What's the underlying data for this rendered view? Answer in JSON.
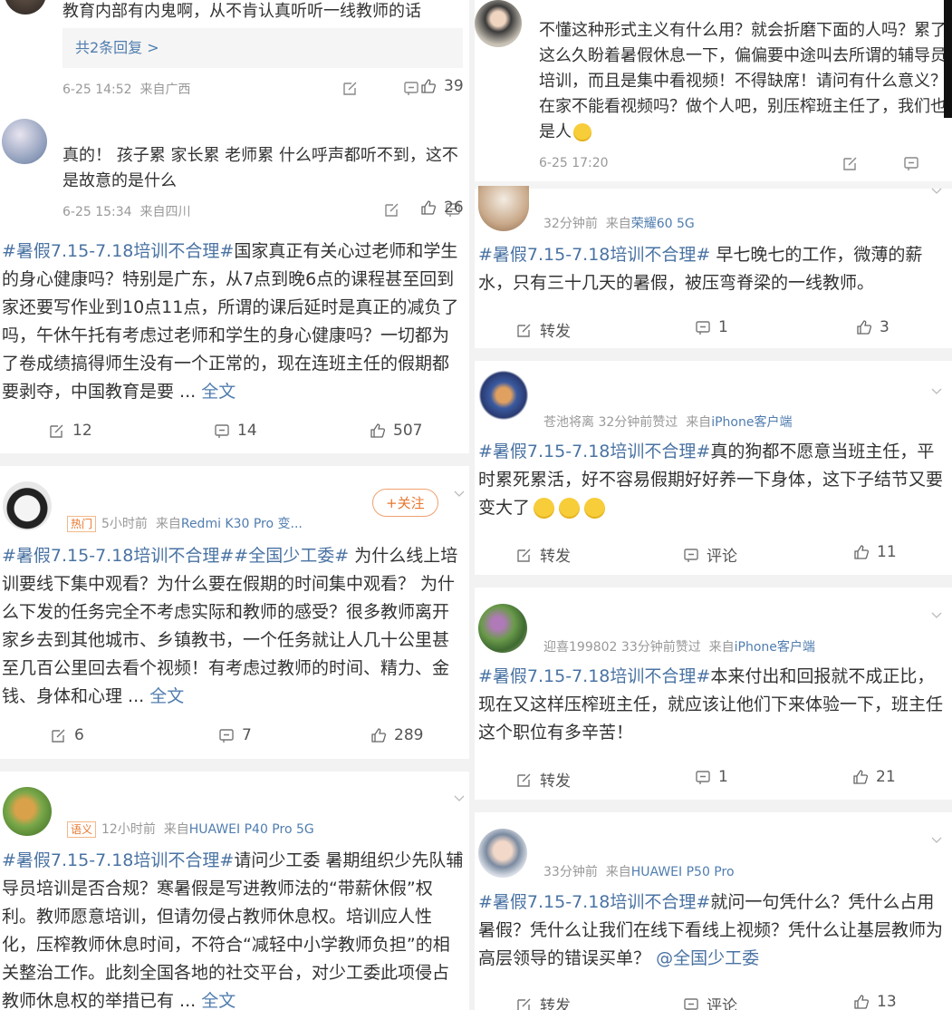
{
  "left": {
    "reply1": {
      "text": "教育内部有内鬼啊，从不肯认真听听一线教师的话",
      "replies_link": "共2条回复 >",
      "time": "6-25 14:52",
      "from": "来自广西",
      "likes": "39"
    },
    "reply2": {
      "text": "真的！ 孩子累 家长累 老师累 什么呼声都听不到，这不是故意的是什么",
      "time": "6-25 15:34",
      "from": "来自四川",
      "likes": "26"
    },
    "post1": {
      "hashtag": "#暑假7.15-7.18培训不合理#",
      "body": "国家真正有关心过老师和学生的身心健康吗？特别是广东，从7点到晚6点的课程甚至回到家还要写作业到10点11点，所谓的课后延时是真正的减负了吗，午休午托有考虑过老师和学生的身心健康吗？一切都为了卷成绩搞得师生没有一个正常的，现在连班主任的假期都要剥夺，中国教育是要 ...",
      "more": "全文",
      "reposts": "12",
      "comments": "14",
      "likes": "507"
    },
    "post2": {
      "badge": "热门",
      "time": "5小时前",
      "from_prefix": "来自",
      "from": "Redmi K30 Pro 变...",
      "follow": "+关注",
      "hashtag": "#暑假7.15-7.18培训不合理##全国少工委#",
      "body": " 为什么线上培训要线下集中观看？为什么要在假期的时间集中观看？ 为什么下发的任务完全不考虑实际和教师的感受？很多教师离开家乡去到其他城市、乡镇教书，一个任务就让人几十公里甚至几百公里回去看个视频！有考虑过教师的时间、精力、金钱、身体和心理 ...",
      "more": "全文",
      "reposts": "6",
      "comments": "7",
      "likes": "289"
    },
    "post3": {
      "badge": "语义",
      "time": "12小时前",
      "from_prefix": "来自",
      "from": "HUAWEI P40 Pro 5G",
      "hashtag": "#暑假7.15-7.18培训不合理#",
      "body": "请问少工委 暑期组织少先队辅导员培训是否合规？寒暑假是写进教师法的“带薪休假”权利。教师愿意培训，但请勿侵占教师休息权。培训应人性化，压榨教师休息时间，不符合“减轻中小学教师负担”的相关整治工作。此刻全国各地的社交平台，对少工委此项侵占教师休息权的举措已有 ...",
      "more": "全文"
    }
  },
  "right": {
    "reply1": {
      "text": "不懂这种形式主义有什么用？就会折磨下面的人吗？累了这么久盼着暑假休息一下，偏偏要中途叫去所谓的辅导员培训，而且是集中看视频！不得缺席！请问有什么意义？在家不能看视频吗？做个人吧，别压榨班主任了，我们也是人",
      "time": "6-25 17:20"
    },
    "post1": {
      "time": "32分钟前",
      "from_prefix": "来自",
      "from": "荣耀60 5G",
      "hashtag": "#暑假7.15-7.18培训不合理#",
      "body": " 早七晚七的工作，微薄的薪水，只有三十几天的暑假，被压弯脊梁的一线教师。",
      "repost": "转发",
      "comments": "1",
      "likes": "3"
    },
    "post2": {
      "user": "苍池将离",
      "time": "32分钟前赞过",
      "from_prefix": "来自",
      "from": "iPhone客户端",
      "hashtag": "#暑假7.15-7.18培训不合理#",
      "body": "真的狗都不愿意当班主任，平时累死累活，好不容易假期好好养一下身体，这下子结节又要变大了",
      "repost": "转发",
      "comment": "评论",
      "likes": "11"
    },
    "post3": {
      "user": "迎喜199802",
      "time": "33分钟前赞过",
      "from_prefix": "来自",
      "from": "iPhone客户端",
      "hashtag": "#暑假7.15-7.18培训不合理#",
      "body": "本来付出和回报就不成正比，现在又这样压榨班主任，就应该让他们下来体验一下，班主任这个职位有多辛苦！",
      "repost": "转发",
      "comments": "1",
      "likes": "21"
    },
    "post4": {
      "time": "33分钟前",
      "from_prefix": "来自",
      "from": "HUAWEI P50 Pro",
      "hashtag": "#暑假7.15-7.18培训不合理#",
      "body": "就问一句凭什么？凭什么占用暑假？凭什么让我们在线下看线上视频？凭什么让基层教师为高层领导的错误买单？",
      "mention": "@全国少工委",
      "repost": "转发",
      "comment": "评论",
      "likes": "13"
    }
  },
  "colors": {
    "link": "#507daf",
    "meta": "#999999",
    "accent": "#e8762d",
    "divider": "#f2f2f2"
  },
  "icons": [
    "edit-icon",
    "comment-icon",
    "like-icon",
    "chevron-down-icon",
    "smile-emoji-icon"
  ]
}
